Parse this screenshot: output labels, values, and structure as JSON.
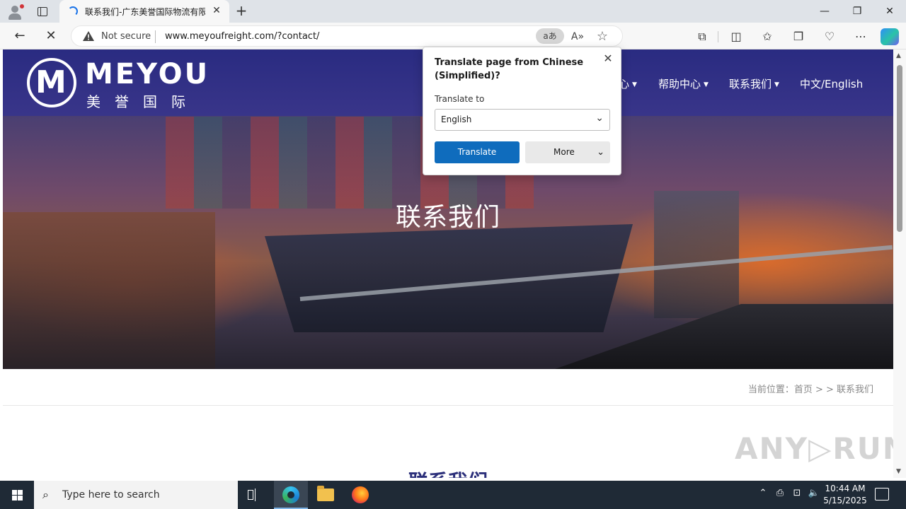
{
  "browser": {
    "tab": {
      "title": "联系我们-广东美誉国际物流有限"
    },
    "address": {
      "security_label": "Not secure",
      "url": "www.meyoufreight.com/?contact/",
      "translate_pill": "aあ",
      "read_aloud": "A)"
    },
    "window": {
      "minimize": "—",
      "restore": "❐",
      "close": "✕"
    }
  },
  "site": {
    "logo": {
      "mark": "M",
      "brand": "MEYOU",
      "subtitle": "美誉国际"
    },
    "nav": {
      "partial_item": "心",
      "help": "帮助中心",
      "contact": "联系我们",
      "language": "中文/English"
    },
    "hero_title": "联系我们",
    "breadcrumb": "当前位置：首页 > > 联系我们",
    "section_title": "联系我们",
    "watermark": "ANY▷RUN"
  },
  "translate_popup": {
    "title": "Translate page from Chinese (Simplified)?",
    "target_label": "Translate to",
    "target_value": "English",
    "translate_button": "Translate",
    "more_button": "More"
  },
  "taskbar": {
    "search_placeholder": "Type here to search",
    "time": "10:44 AM",
    "date": "5/15/2025"
  }
}
